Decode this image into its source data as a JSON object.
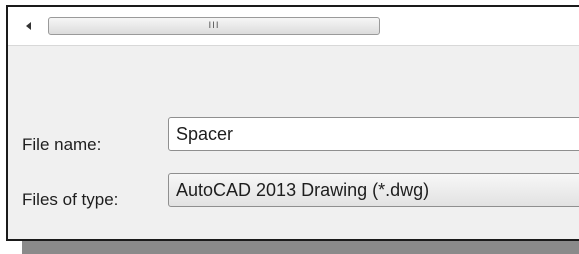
{
  "scrollbar": {
    "left_arrow_icon": "arrow-left-icon",
    "thumb_grip": "III"
  },
  "form": {
    "file_name_label": "File name:",
    "file_name_value": "Spacer",
    "file_type_label": "Files of type:",
    "file_type_value": "AutoCAD 2013 Drawing (*.dwg)"
  }
}
